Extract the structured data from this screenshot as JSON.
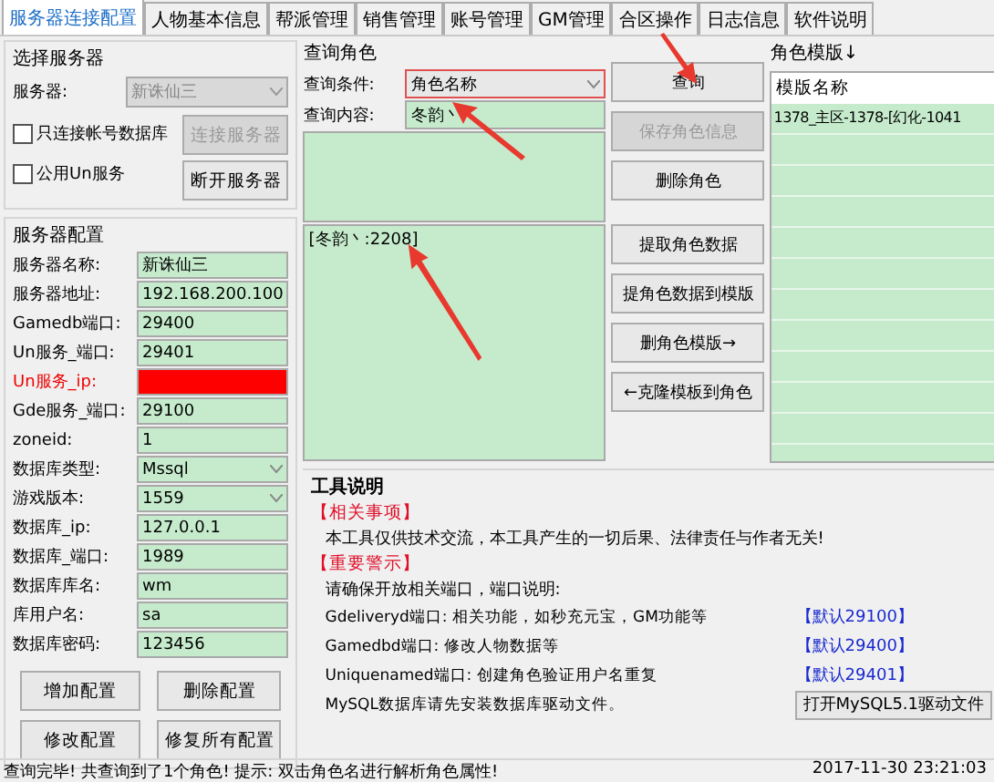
{
  "tabs": [
    {
      "label": "服务器连接配置",
      "selected": true
    },
    {
      "label": "人物基本信息",
      "selected": false
    },
    {
      "label": "帮派管理",
      "selected": false
    },
    {
      "label": "销售管理",
      "selected": false
    },
    {
      "label": "账号管理",
      "selected": false
    },
    {
      "label": "GM管理",
      "selected": false
    },
    {
      "label": "合区操作",
      "selected": false
    },
    {
      "label": "日志信息",
      "selected": false
    },
    {
      "label": "软件说明",
      "selected": false
    }
  ],
  "server_select": {
    "title": "选择服务器",
    "label": "服务器:",
    "value": "新诛仙三",
    "disabled": true,
    "checkboxes": [
      {
        "label": "只连接帐号数据库",
        "checked": false
      },
      {
        "label": "公用Un服务",
        "checked": false
      }
    ],
    "buttons": [
      {
        "label": "连接服务器",
        "disabled": true
      },
      {
        "label": "断开服务器",
        "disabled": false
      }
    ]
  },
  "server_config": {
    "title": "服务器配置",
    "fields": [
      {
        "label": "服务器名称:",
        "value": "新诛仙三",
        "kind": "text",
        "invalid": false
      },
      {
        "label": "服务器地址:",
        "value": "192.168.200.100",
        "kind": "text",
        "invalid": false
      },
      {
        "label": "Gamedb端口:",
        "value": "29400",
        "kind": "text",
        "invalid": false
      },
      {
        "label": "Un服务_端口:",
        "value": "29401",
        "kind": "text",
        "invalid": false
      },
      {
        "label": "Un服务_ip:",
        "kind": "text",
        "invalid": true
      },
      {
        "label": "Gde服务_端口:",
        "value": "29100",
        "kind": "text",
        "invalid": false
      },
      {
        "label": "zoneid:",
        "value": "1",
        "kind": "text",
        "invalid": false
      },
      {
        "label": "数据库类型:",
        "value": "Mssql",
        "kind": "select",
        "invalid": false
      },
      {
        "label": "游戏版本:",
        "value": "1559",
        "kind": "select",
        "invalid": false
      },
      {
        "label": "数据库_ip:",
        "value": "127.0.0.1",
        "kind": "text",
        "invalid": false
      },
      {
        "label": "数据库_端口:",
        "value": "1989",
        "kind": "text",
        "invalid": false
      },
      {
        "label": "数据库库名:",
        "value": "wm",
        "kind": "text",
        "invalid": false
      },
      {
        "label": "库用户名:",
        "value": "sa",
        "kind": "text",
        "invalid": false
      },
      {
        "label": "数据库密码:",
        "value": "123456",
        "kind": "text",
        "invalid": false
      }
    ],
    "buttons": [
      "增加配置",
      "删除配置",
      "修改配置",
      "修复所有配置"
    ]
  },
  "query": {
    "title": "查询角色",
    "condition_label": "查询条件:",
    "condition": "角色名称",
    "content_label": "查询内容:",
    "content": "冬韵丶",
    "results": [
      "[冬韵丶:2208]"
    ]
  },
  "actions": [
    {
      "label": "查询",
      "disabled": false
    },
    {
      "label": "保存角色信息",
      "disabled": true
    },
    {
      "label": "删除角色",
      "disabled": false
    },
    {
      "label": "提取角色数据",
      "disabled": false
    },
    {
      "label": "提角色数据到模版",
      "disabled": false
    },
    {
      "label": "删角色模版→",
      "disabled": false
    },
    {
      "label": "←克隆模板到角色",
      "disabled": false
    }
  ],
  "templates": {
    "title": "角色模版↓",
    "header": "模版名称",
    "rows": [
      "1378_主区-1378-[幻化-1041"
    ]
  },
  "tool_info": {
    "title": "工具说明",
    "items": [
      {
        "kind": "heading",
        "text": "【相关事项】"
      },
      {
        "kind": "text",
        "text": "本工具仅供技术交流，本工具产生的一切后果、法律责任与作者无关!"
      },
      {
        "kind": "heading",
        "text": "【重要警示】"
      },
      {
        "kind": "text",
        "text": "请确保开放相关端口，端口说明:"
      },
      {
        "kind": "port",
        "text": "Gdeliveryd端口: 相关功能，如秒充元宝，GM功能等",
        "default": "【默认29100】"
      },
      {
        "kind": "port",
        "text": "Gamedbd端口: 修改人物数据等",
        "default": "【默认29400】"
      },
      {
        "kind": "port",
        "text": "Uniquenamed端口: 创建角色验证用户名重复",
        "default": "【默认29401】"
      },
      {
        "kind": "action",
        "text": "MySQL数据库请先安装数据库驱动文件。",
        "button": "打开MySQL5.1驱动文件"
      }
    ]
  },
  "status_bar": {
    "message": "查询完毕! 共查询到了1个角色! 提示: 双击角色名进行解析角色属性!",
    "time": "2017-11-30 23:21:03"
  }
}
